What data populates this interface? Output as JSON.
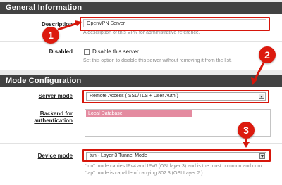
{
  "general": {
    "header": "General Information",
    "description": {
      "label": "Description",
      "value": "OpenVPN Server",
      "help": "A description of this VPN for administrative reference."
    },
    "disabled": {
      "label": "Disabled",
      "checkbox_label": "Disable this server",
      "checked": false,
      "help": "Set this option to disable this server without removing it from the list."
    }
  },
  "mode": {
    "header": "Mode Configuration",
    "server_mode": {
      "label": "Server mode",
      "value": "Remote Access ( SSL/TLS + User Auth )"
    },
    "backend": {
      "label_line1": "Backend for",
      "label_line2": "authentication",
      "options": [
        "Local Database"
      ],
      "selected": "Local Database"
    },
    "device_mode": {
      "label": "Device mode",
      "value": "tun - Layer 3 Tunnel Mode",
      "help_line1": "\"tun\" mode carries IPv4 and IPv6 (OSI layer 3) and is the most common and com",
      "help_line2": "\"tap\" mode is capable of carrying 802.3 (OSI Layer 2.)"
    }
  },
  "annotations": {
    "badge1": "1",
    "badge2": "2",
    "badge3": "3",
    "color": "#d6160b"
  },
  "colors": {
    "section_header_bg": "#424242",
    "page_bg": "#ebebeb",
    "selected_option_bg": "#e48ba0"
  }
}
